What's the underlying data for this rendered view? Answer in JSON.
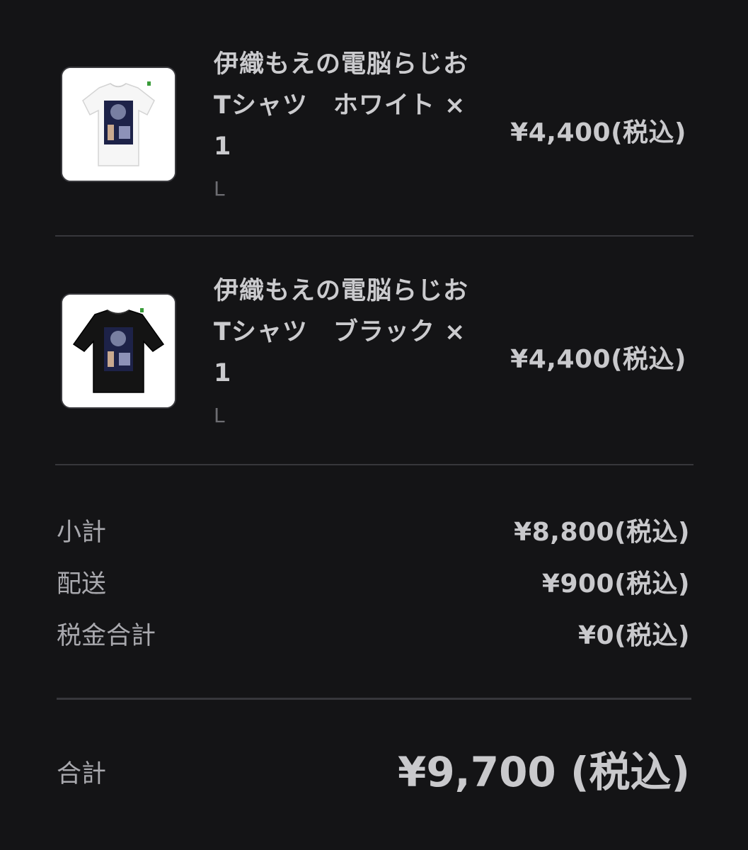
{
  "items": [
    {
      "title": "伊織もえの電脳らじお Tシャツ　ホワイト × 1",
      "variant": "L",
      "price": "¥4,400(税込)",
      "shirt_color": "#ffffff",
      "thumbnail_icon": "white-tshirt-image"
    },
    {
      "title": "伊織もえの電脳らじお Tシャツ　ブラック × 1",
      "variant": "L",
      "price": "¥4,400(税込)",
      "shirt_color": "#111111",
      "thumbnail_icon": "black-tshirt-image"
    }
  ],
  "summary": {
    "subtotal": {
      "label": "小計",
      "value": "¥8,800(税込)"
    },
    "shipping": {
      "label": "配送",
      "value": "¥900(税込)"
    },
    "tax": {
      "label": "税金合計",
      "value": "¥0(税込)"
    }
  },
  "total": {
    "label": "合計",
    "value": "¥9,700 (税込)"
  },
  "colors": {
    "background": "#141416",
    "divider": "#37373b",
    "text_primary": "#c9c9cc",
    "text_secondary": "#6d6d72"
  }
}
